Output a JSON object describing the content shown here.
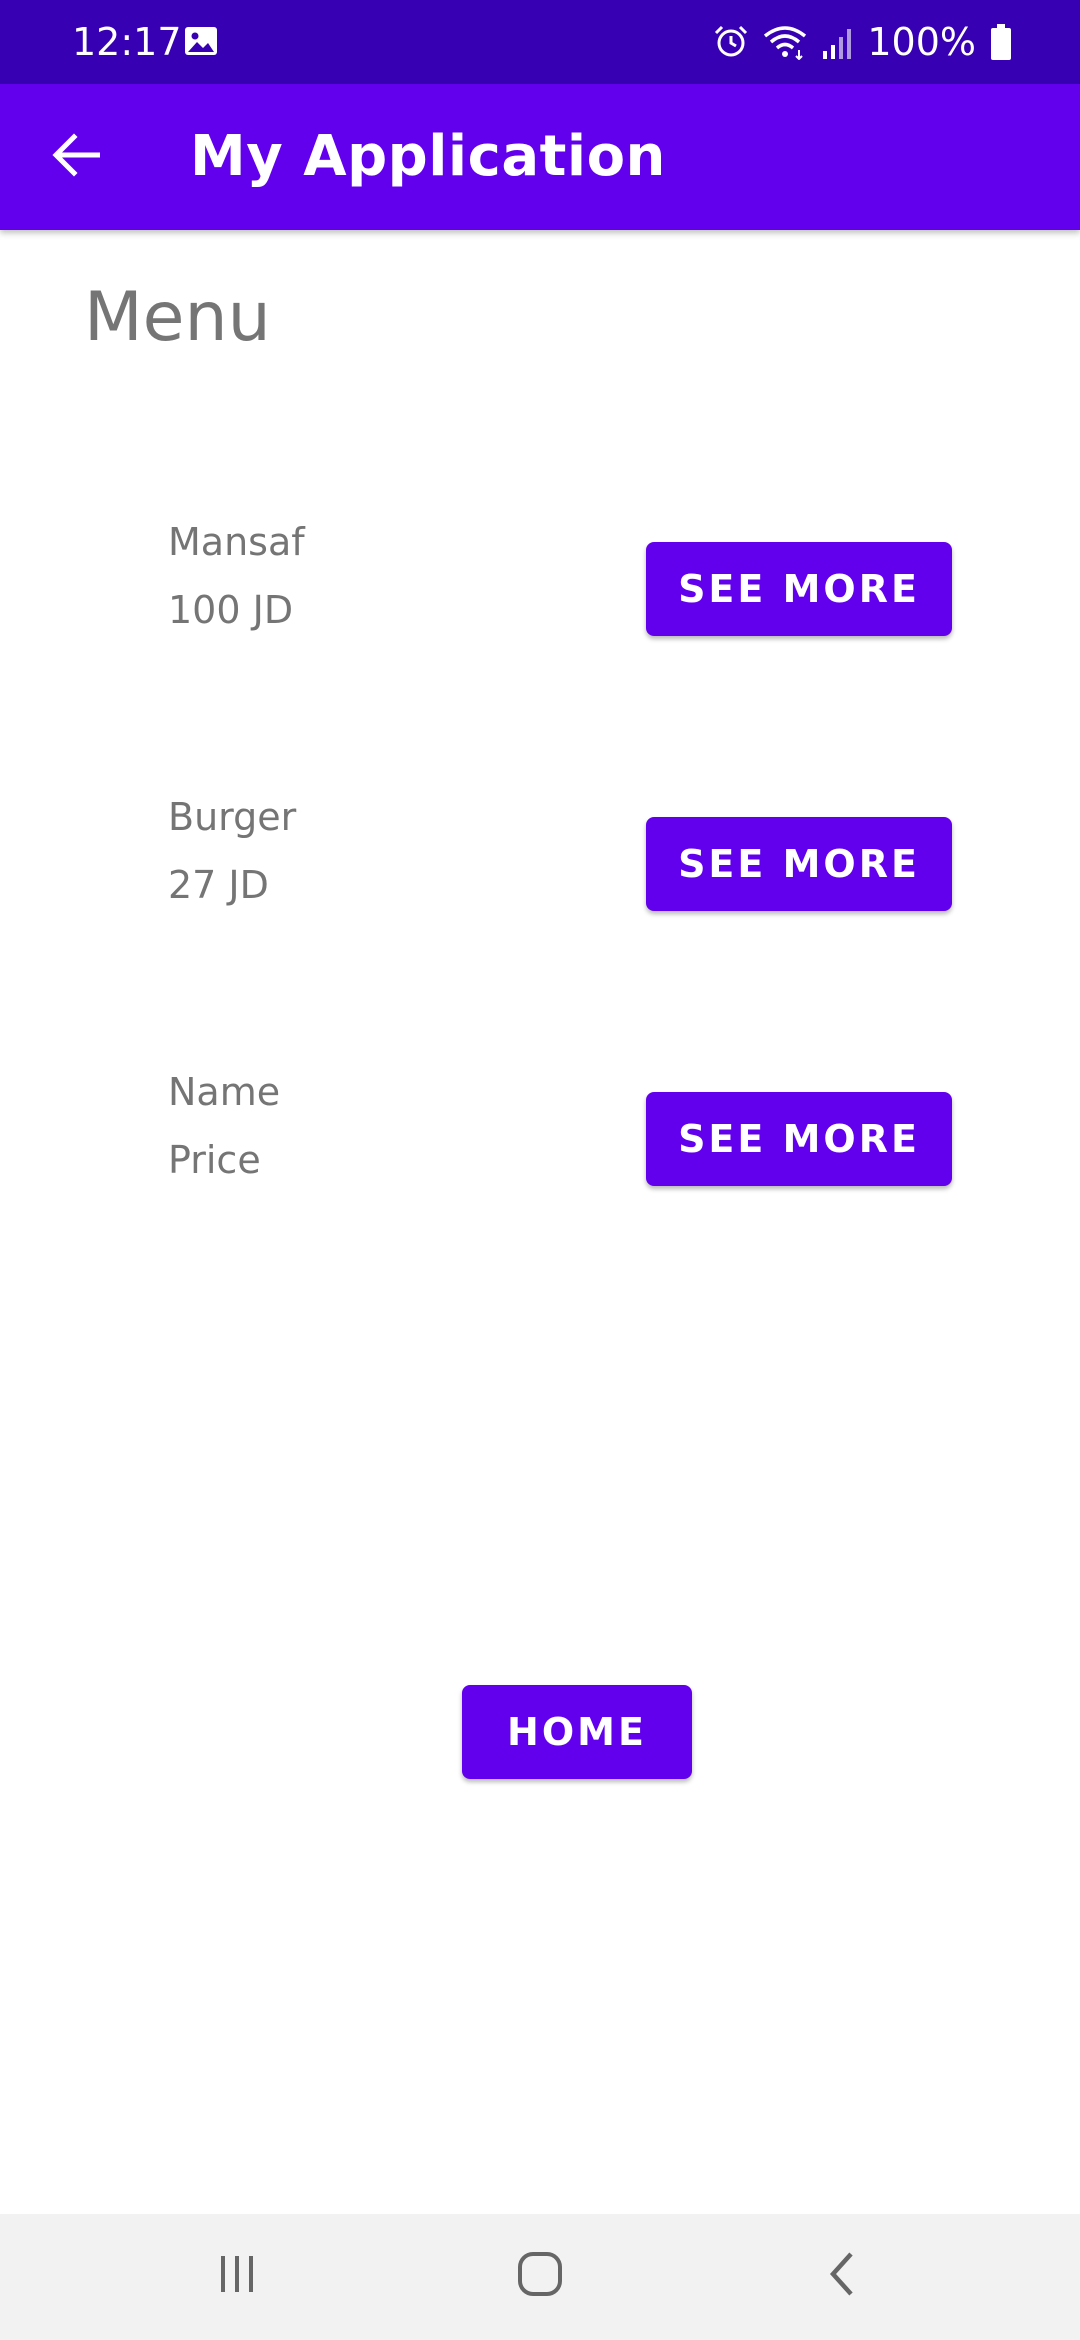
{
  "status_bar": {
    "time": "12:17",
    "battery_percent": "100%",
    "icons": [
      "image-icon",
      "alarm-icon",
      "wifi-icon",
      "signal-icon",
      "battery-icon"
    ]
  },
  "app_bar": {
    "title": "My Application",
    "back_icon": "arrow-back-icon",
    "color": "#6200EE"
  },
  "menu": {
    "heading": "Menu",
    "items": [
      {
        "name": "Mansaf",
        "price": "100 JD",
        "button_label": "SEE MORE"
      },
      {
        "name": "Burger",
        "price": "27 JD",
        "button_label": "SEE MORE"
      },
      {
        "name": "Name",
        "price": "Price",
        "button_label": "SEE MORE"
      }
    ]
  },
  "home_button": {
    "label": "HOME"
  },
  "nav_bar": {
    "icons": [
      "recent-apps-icon",
      "home-icon",
      "back-icon"
    ]
  },
  "colors": {
    "primary": "#6200EE",
    "primary_dark": "#3700B3",
    "text_secondary": "#757575"
  }
}
